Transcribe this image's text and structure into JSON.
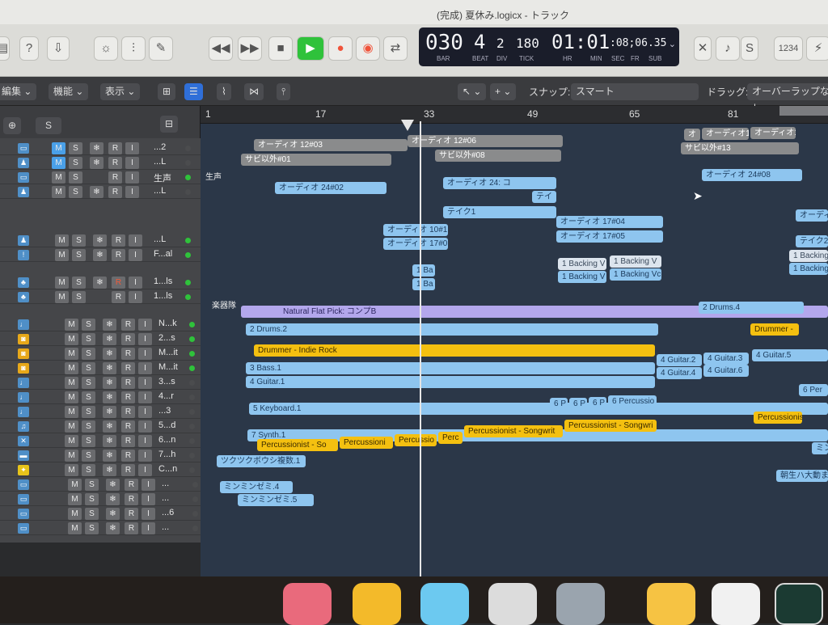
{
  "window": {
    "title": "(完成) 夏休み.logicx - トラック"
  },
  "lcd": {
    "bar": "030",
    "beat": "4",
    "div": "2",
    "tick": "180",
    "time": "01:01",
    "sub": ":08;06.35",
    "labels": {
      "bar": "BAR",
      "beat": "BEAT",
      "div": "DIV",
      "tick": "TICK",
      "hr": "HR",
      "min": "MIN",
      "sec": "SEC",
      "fr": "FR",
      "subl": "SUB"
    }
  },
  "toolbar": {
    "cpu": "1234",
    "help": "?"
  },
  "editbar": {
    "edit": "編集",
    "functions": "機能",
    "view": "表示",
    "snap_label": "スナップ:",
    "snap_value": "スマート",
    "drag_label": "ドラッグ:",
    "drag_value": "オーバーラップなし"
  },
  "header": {
    "s_button": "S"
  },
  "tracks": [
    {
      "name": "...2",
      "m": "M",
      "s": "S",
      "r": "R",
      "i": "I"
    },
    {
      "name": "...L",
      "m": "M",
      "s": "S",
      "r": "R",
      "i": "I"
    },
    {
      "name": "生声",
      "m": "M",
      "s": "S",
      "r": "R",
      "i": "I"
    },
    {
      "name": "...L",
      "m": "M",
      "s": "S",
      "r": "R",
      "i": "I"
    },
    {
      "name": "...L",
      "m": "M",
      "s": "S",
      "r": "R",
      "i": "I"
    },
    {
      "name": "F...al",
      "m": "M",
      "s": "S",
      "r": "R",
      "i": "I"
    },
    {
      "name": "1...ls",
      "m": "M",
      "s": "S",
      "r": "R",
      "i": "I"
    },
    {
      "name": "1...ls",
      "m": "M",
      "s": "S",
      "r": "R",
      "i": "I"
    },
    {
      "name": "N...k",
      "m": "M",
      "s": "S",
      "r": "R",
      "i": "I"
    },
    {
      "name": "2...s",
      "m": "M",
      "s": "S",
      "r": "R",
      "i": "I"
    },
    {
      "name": "M...it",
      "m": "M",
      "s": "S",
      "r": "R",
      "i": "I"
    },
    {
      "name": "M...it",
      "m": "M",
      "s": "S",
      "r": "R",
      "i": "I"
    },
    {
      "name": "3...s",
      "m": "M",
      "s": "S",
      "r": "R",
      "i": "I"
    },
    {
      "name": "4...r",
      "m": "M",
      "s": "S",
      "r": "R",
      "i": "I"
    },
    {
      "name": "...3",
      "m": "M",
      "s": "S",
      "r": "R",
      "i": "I"
    },
    {
      "name": "5...d",
      "m": "M",
      "s": "S",
      "r": "R",
      "i": "I"
    },
    {
      "name": "6...n",
      "m": "M",
      "s": "S",
      "r": "R",
      "i": "I"
    },
    {
      "name": "7...h",
      "m": "M",
      "s": "S",
      "r": "R",
      "i": "I"
    },
    {
      "name": "C...n",
      "m": "M",
      "s": "S",
      "r": "R",
      "i": "I"
    },
    {
      "name": "...",
      "m": "M",
      "s": "S",
      "r": "R",
      "i": "I"
    },
    {
      "name": "...",
      "m": "M",
      "s": "S",
      "r": "R",
      "i": "I"
    },
    {
      "name": "...6",
      "m": "M",
      "s": "S",
      "r": "R",
      "i": "I"
    },
    {
      "name": "...",
      "m": "M",
      "s": "S",
      "r": "R",
      "i": "I"
    }
  ],
  "ruler": [
    "1",
    "17",
    "33",
    "49",
    "65",
    "81"
  ],
  "folder_labels": {
    "vocal": "生声",
    "band": "楽器隊"
  },
  "regions": {
    "r1": "オーディオ 12#03",
    "r2": "オーディオ 12#06",
    "r3": "サビ以外#01",
    "r4": "サビ以外#08",
    "r5": "オーディオ 24#02",
    "r6": "オーディオ 24: コ",
    "r7": "テイク1",
    "r8": "テイ",
    "r9": "オーディオ 10#1",
    "r10": "オーディオ 17#0",
    "r11": "オーディオ 17#04",
    "r12": "オーディオ 17#05",
    "r13": "1 Backing V",
    "r14": "1 Backing V",
    "r15": "1 Backing V",
    "r16": "1 Backing Vc",
    "r17": "1 Ba",
    "r18": "1 Ba",
    "r19": "オ",
    "r20": "オーディオ1",
    "r21": "オーディオ1",
    "r22": "サビ以外#13",
    "r23": "オーディオ 24#08",
    "r24": "オーディ",
    "r25": "テイク2",
    "r26": "1 Backing",
    "r27": "1 Backing",
    "r28": "Natural Flat Pick: コンプB",
    "r29": "2 Drums.2",
    "r30": "2 Drums.4",
    "r31": "Drummer -",
    "r32": "Drummer - Indie Rock",
    "r33": "3 Bass.1",
    "r34": "4 Guitar.1",
    "r35": "4 Guitar.2",
    "r36": "4 Guitar.3",
    "r37": "4 Guitar.5",
    "r38": "4 Guitar.4",
    "r39": "4 Guitar.6",
    "r40": "5 Keyboard.1",
    "r41": "6 P",
    "r42": "6 P",
    "r43": "6 P",
    "r44": "6 Percussio",
    "r45": "6 Per",
    "r46": "7 Synth.1",
    "r47": "Percussionist - So",
    "r48": "Percussioni",
    "r49": "Percussio",
    "r50": "Perc",
    "r51": "Percussionist - Songwrit",
    "r52": "Percussionist - Songwri",
    "r53": "Percussionis",
    "r54": "ツクツクボウシ複数.1",
    "r55": "ミンミンゼミ.4",
    "r56": "ミンミンゼミ.5",
    "r57": "ミン",
    "r58": "朝生ハ大動まっ"
  },
  "colors": {
    "accent_green": "#2fc23b",
    "region_blue": "#8ec5ef",
    "region_yellow": "#f4c010",
    "region_purple": "#b3a7ec"
  }
}
